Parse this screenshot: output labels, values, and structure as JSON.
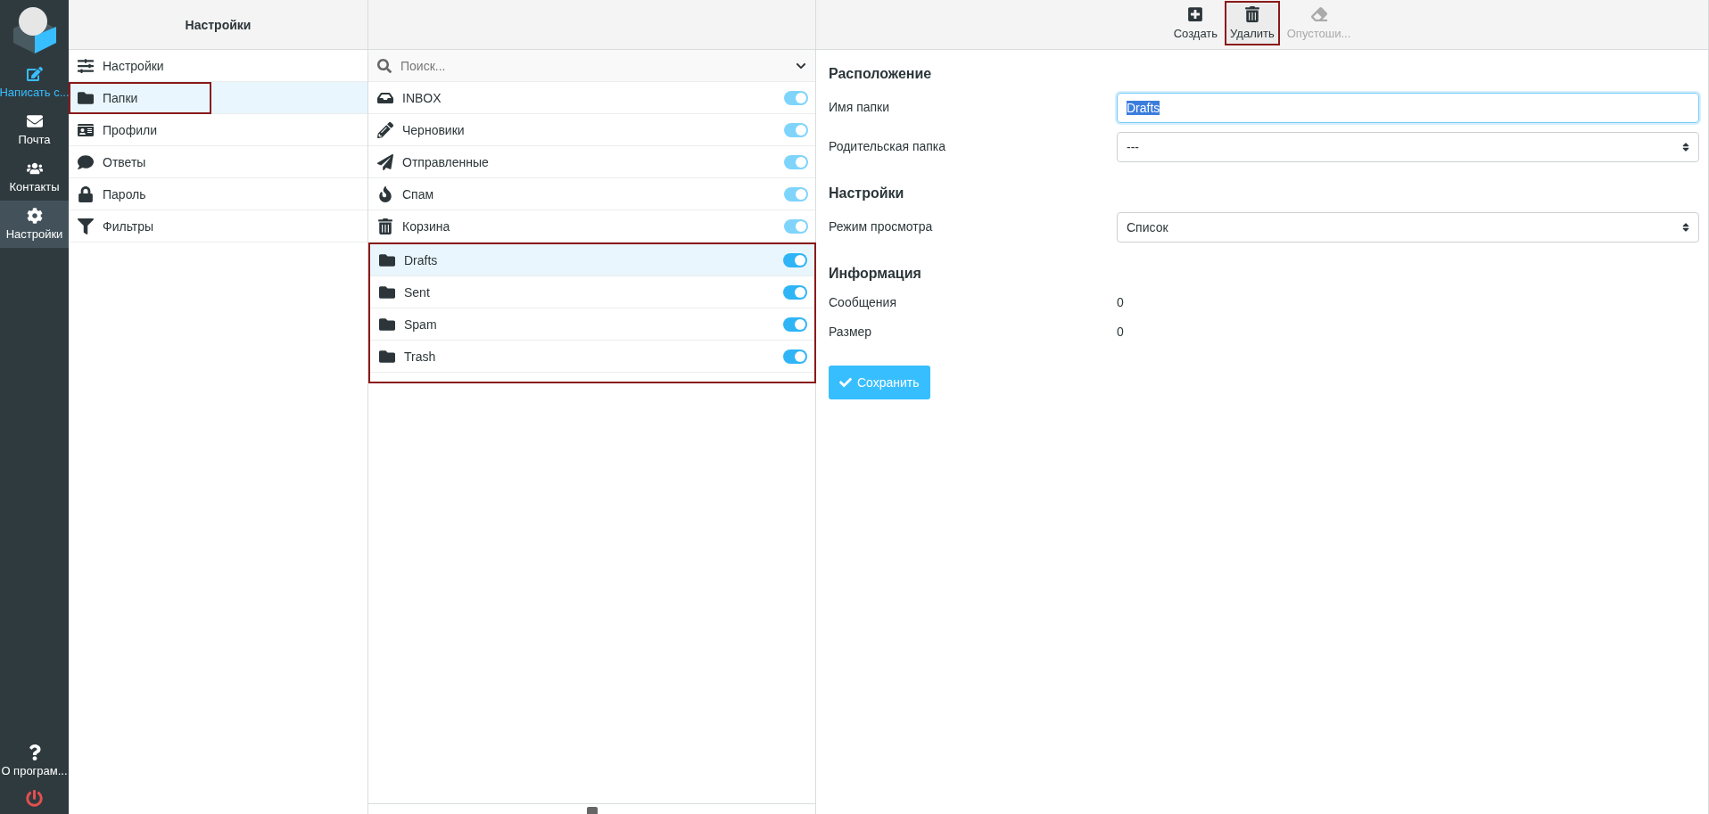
{
  "nav": {
    "items": [
      {
        "label": "Написать с...",
        "kind": "primary",
        "selected": false
      },
      {
        "label": "Почта",
        "kind": "normal",
        "selected": false
      },
      {
        "label": "Контакты",
        "kind": "normal",
        "selected": false
      },
      {
        "label": "Настройки",
        "kind": "normal",
        "selected": true
      }
    ],
    "about": "О програм..."
  },
  "settings_menu": {
    "title": "Настройки",
    "items": [
      {
        "label": "Настройки",
        "selected": false,
        "highlighted": false
      },
      {
        "label": "Папки",
        "selected": true,
        "highlighted": true
      },
      {
        "label": "Профили",
        "selected": false,
        "highlighted": false
      },
      {
        "label": "Ответы",
        "selected": false,
        "highlighted": false
      },
      {
        "label": "Пароль",
        "selected": false,
        "highlighted": false
      },
      {
        "label": "Фильтры",
        "selected": false,
        "highlighted": false
      }
    ]
  },
  "folder_list": {
    "search": {
      "placeholder": "Поиск..."
    },
    "special_folders": [
      {
        "name": "INBOX",
        "on": true,
        "disabled": true
      },
      {
        "name": "Черновики",
        "on": true,
        "disabled": true
      },
      {
        "name": "Отправленные",
        "on": true,
        "disabled": true
      },
      {
        "name": "Спам",
        "on": true,
        "disabled": true
      },
      {
        "name": "Корзина",
        "on": true,
        "disabled": true
      }
    ],
    "custom_folders": {
      "highlighted": true,
      "items": [
        {
          "name": "Drafts",
          "selected": true,
          "on": true
        },
        {
          "name": "Sent",
          "selected": false,
          "on": true
        },
        {
          "name": "Spam",
          "selected": false,
          "on": true
        },
        {
          "name": "Trash",
          "selected": false,
          "on": true
        }
      ]
    }
  },
  "toolbar": {
    "buttons": [
      {
        "label": "Создать",
        "disabled": false,
        "highlighted": false
      },
      {
        "label": "Удалить",
        "disabled": false,
        "highlighted": true
      },
      {
        "label": "Опустоши...",
        "disabled": true,
        "highlighted": false
      }
    ]
  },
  "form": {
    "sections": [
      {
        "title": "Расположение",
        "fields": [
          {
            "label": "Имя папки",
            "kind": "text",
            "value": "Drafts"
          },
          {
            "label": "Родительская папка",
            "kind": "select",
            "value": "---"
          }
        ]
      },
      {
        "title": "Настройки",
        "fields": [
          {
            "label": "Режим просмотра",
            "kind": "select",
            "value": "Список"
          }
        ]
      },
      {
        "title": "Информация",
        "fields": [
          {
            "label": "Сообщения",
            "kind": "info",
            "value": "0"
          },
          {
            "label": "Размер",
            "kind": "info",
            "value": "0"
          }
        ]
      }
    ],
    "save_button": "Сохранить"
  }
}
